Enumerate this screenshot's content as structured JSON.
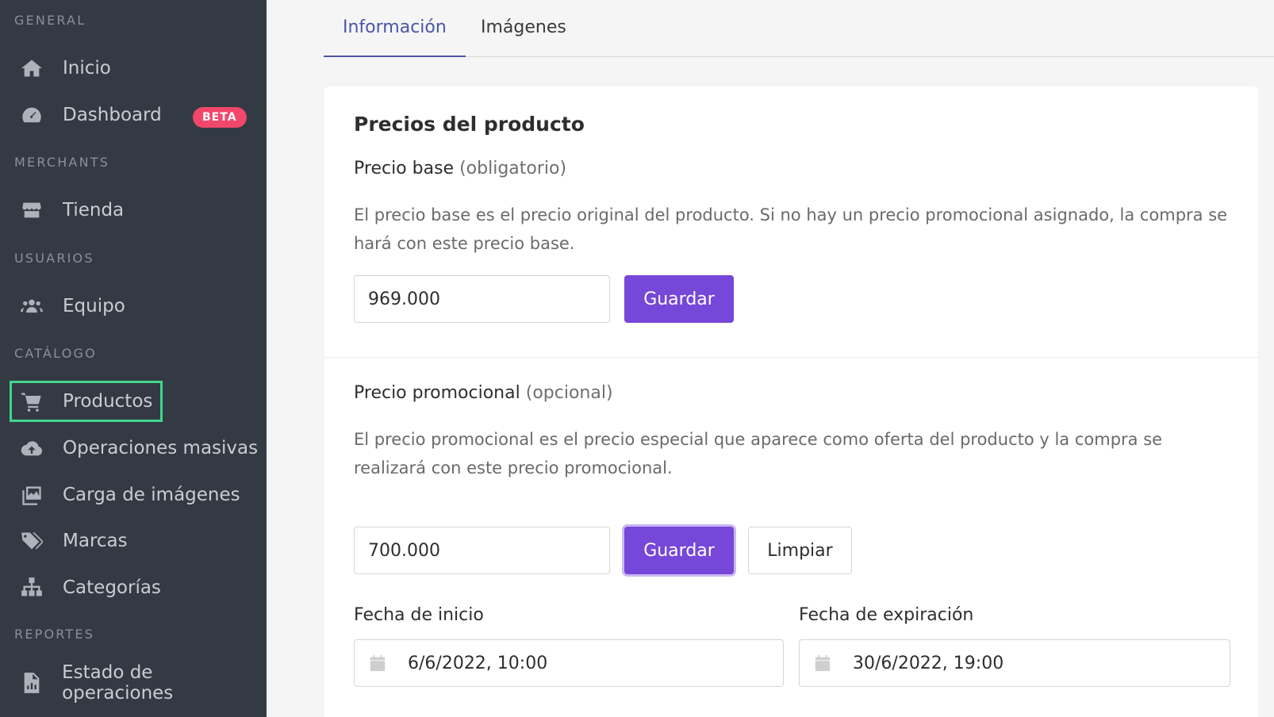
{
  "sidebar": {
    "sections": {
      "general": "GENERAL",
      "merchants": "MERCHANTS",
      "usuarios": "USUARIOS",
      "catalogo": "CATÁLOGO",
      "reportes": "REPORTES"
    },
    "items": {
      "inicio": "Inicio",
      "dashboard": "Dashboard",
      "dashboard_badge": "BETA",
      "tienda": "Tienda",
      "equipo": "Equipo",
      "productos": "Productos",
      "operaciones": "Operaciones masivas",
      "carga_imagenes": "Carga de imágenes",
      "marcas": "Marcas",
      "categorias": "Categorías",
      "estado_operaciones": "Estado de operaciones"
    },
    "active_item": "Productos"
  },
  "tabs": {
    "informacion": "Información",
    "imagenes": "Imágenes",
    "active": "Información"
  },
  "card": {
    "title": "Precios del producto",
    "base": {
      "label": "Precio base",
      "qualifier": "(obligatorio)",
      "description": "El precio base es el precio original del producto. Si no hay un precio promocional asignado, la compra se hará con este precio base.",
      "value": "969.000",
      "save_label": "Guardar"
    },
    "promo": {
      "label": "Precio promocional",
      "qualifier": "(opcional)",
      "description": "El precio promocional es el precio especial que aparece como oferta del producto y la compra se realizará con este precio promocional.",
      "value": "700.000",
      "save_label": "Guardar",
      "clear_label": "Limpiar"
    },
    "start_date": {
      "label": "Fecha de inicio",
      "value": "6/6/2022, 10:00"
    },
    "end_date": {
      "label": "Fecha de expiración",
      "value": "30/6/2022, 19:00"
    }
  },
  "colors": {
    "sidebar_bg": "#343a44",
    "primary": "#7647d8",
    "active_tab": "#4a56a6",
    "badge": "#f0476a",
    "highlight": "#3fd68c"
  }
}
